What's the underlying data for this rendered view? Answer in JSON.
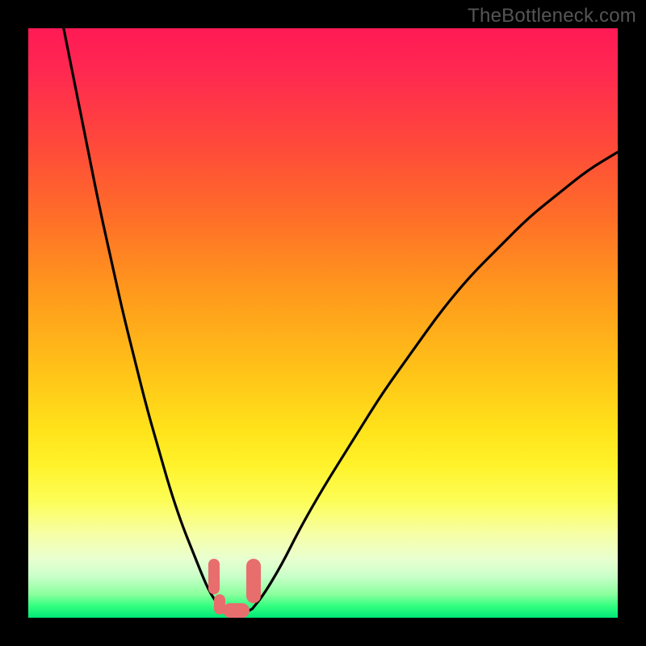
{
  "watermark": "TheBottleneck.com",
  "colors": {
    "frame": "#000000",
    "curve": "#000000",
    "marker": "#e86d6d"
  },
  "chart_data": {
    "type": "line",
    "title": "",
    "xlabel": "",
    "ylabel": "",
    "xlim": [
      0,
      100
    ],
    "ylim": [
      0,
      100
    ],
    "grid": false,
    "series": [
      {
        "name": "left_curve",
        "x": [
          6,
          8,
          10,
          12,
          14,
          16,
          18,
          20,
          22,
          24,
          26,
          28,
          30,
          31,
          32,
          33
        ],
        "y": [
          100,
          90,
          80,
          70,
          61,
          52,
          44,
          36,
          29,
          22,
          16,
          11,
          6,
          4,
          2.5,
          1.5
        ]
      },
      {
        "name": "valley_floor",
        "x": [
          33,
          34,
          35,
          36,
          37,
          38
        ],
        "y": [
          1.5,
          1,
          0.8,
          0.8,
          1,
          1.5
        ]
      },
      {
        "name": "right_curve",
        "x": [
          38,
          40,
          43,
          46,
          50,
          55,
          60,
          65,
          70,
          75,
          80,
          85,
          90,
          95,
          100
        ],
        "y": [
          1.5,
          4,
          9,
          15,
          22,
          30,
          38,
          45,
          52,
          58,
          63,
          68,
          72,
          76,
          79
        ]
      }
    ],
    "markers": [
      {
        "name": "left-upper",
        "x_range": [
          30.5,
          32.5
        ],
        "y_range": [
          4,
          10
        ]
      },
      {
        "name": "left-lower",
        "x_range": [
          31.5,
          33.5
        ],
        "y_range": [
          0.5,
          4
        ]
      },
      {
        "name": "bottom",
        "x_range": [
          33,
          37.5
        ],
        "y_range": [
          0,
          2.5
        ]
      },
      {
        "name": "right",
        "x_range": [
          37,
          39.5
        ],
        "y_range": [
          2.5,
          10
        ]
      }
    ]
  }
}
